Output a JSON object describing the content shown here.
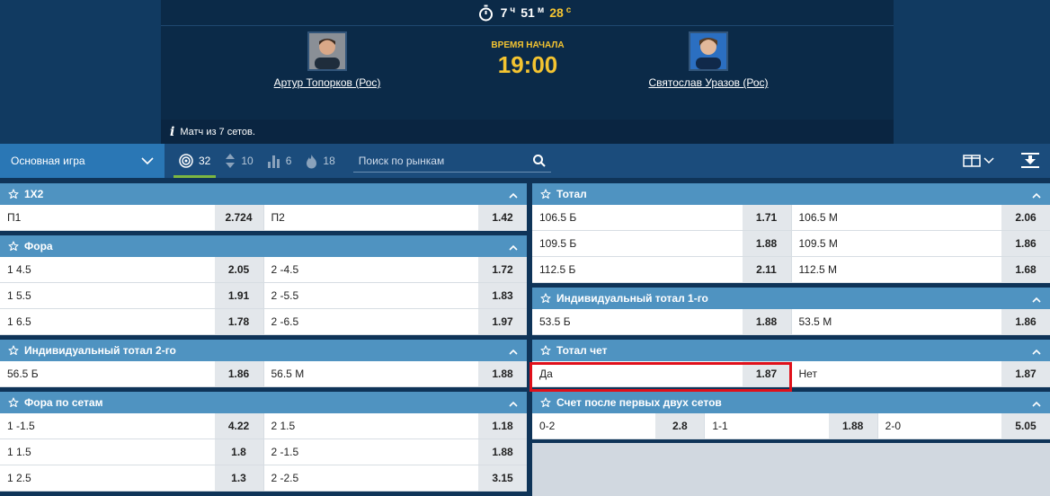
{
  "timer": {
    "h": "7",
    "h_unit": "ч",
    "m": "51",
    "m_unit": "м",
    "s": "28",
    "s_unit": "с"
  },
  "match": {
    "team1": "Артур Топорков (Рос)",
    "team2": "Святослав Уразов (Рос)",
    "start_label": "ВРЕМЯ НАЧАЛА",
    "start_time": "19:00",
    "info": "Матч из 7 сетов."
  },
  "toolbar": {
    "select_label": "Основная игра",
    "tabs": [
      {
        "icon": "target-icon",
        "count": "32"
      },
      {
        "icon": "updown-icon",
        "count": "10"
      },
      {
        "icon": "bars-icon",
        "count": "6"
      },
      {
        "icon": "fire-icon",
        "count": "18"
      }
    ],
    "search_placeholder": "Поиск по рынкам"
  },
  "left_sections": [
    {
      "title": "1X2",
      "rows": [
        [
          [
            "П1",
            "2.724"
          ],
          [
            "П2",
            "1.42"
          ]
        ]
      ]
    },
    {
      "title": "Фора",
      "rows": [
        [
          [
            "1 4.5",
            "2.05"
          ],
          [
            "2 -4.5",
            "1.72"
          ]
        ],
        [
          [
            "1 5.5",
            "1.91"
          ],
          [
            "2 -5.5",
            "1.83"
          ]
        ],
        [
          [
            "1 6.5",
            "1.78"
          ],
          [
            "2 -6.5",
            "1.97"
          ]
        ]
      ]
    },
    {
      "title": "Индивидуальный тотал 2-го",
      "rows": [
        [
          [
            "56.5 Б",
            "1.86"
          ],
          [
            "56.5 М",
            "1.88"
          ]
        ]
      ]
    },
    {
      "title": "Фора по сетам",
      "rows": [
        [
          [
            "1 -1.5",
            "4.22"
          ],
          [
            "2 1.5",
            "1.18"
          ]
        ],
        [
          [
            "1 1.5",
            "1.8"
          ],
          [
            "2 -1.5",
            "1.88"
          ]
        ],
        [
          [
            "1 2.5",
            "1.3"
          ],
          [
            "2 -2.5",
            "3.15"
          ]
        ]
      ]
    }
  ],
  "right_sections": [
    {
      "title": "Тотал",
      "rows": [
        [
          [
            "106.5 Б",
            "1.71"
          ],
          [
            "106.5 М",
            "2.06"
          ]
        ],
        [
          [
            "109.5 Б",
            "1.88"
          ],
          [
            "109.5 М",
            "1.86"
          ]
        ],
        [
          [
            "112.5 Б",
            "2.11"
          ],
          [
            "112.5 М",
            "1.68"
          ]
        ]
      ]
    },
    {
      "title": "Индивидуальный тотал 1-го",
      "rows": [
        [
          [
            "53.5 Б",
            "1.88"
          ],
          [
            "53.5 М",
            "1.86"
          ]
        ]
      ]
    },
    {
      "title": "Тотал чет",
      "rows": [
        [
          [
            "Да",
            "1.87"
          ],
          [
            "Нет",
            "1.87"
          ]
        ]
      ]
    },
    {
      "title": "Счет после первых двух сетов",
      "rows": [
        [
          [
            "0-2",
            "2.8"
          ],
          [
            "1-1",
            "1.88"
          ],
          [
            "2-0",
            "5.05"
          ]
        ]
      ]
    }
  ],
  "colors": {
    "header_bg": "#0b2a48",
    "accent_yellow": "#f4c431",
    "section_header": "#4f93c1",
    "highlight": "#e0101a"
  }
}
